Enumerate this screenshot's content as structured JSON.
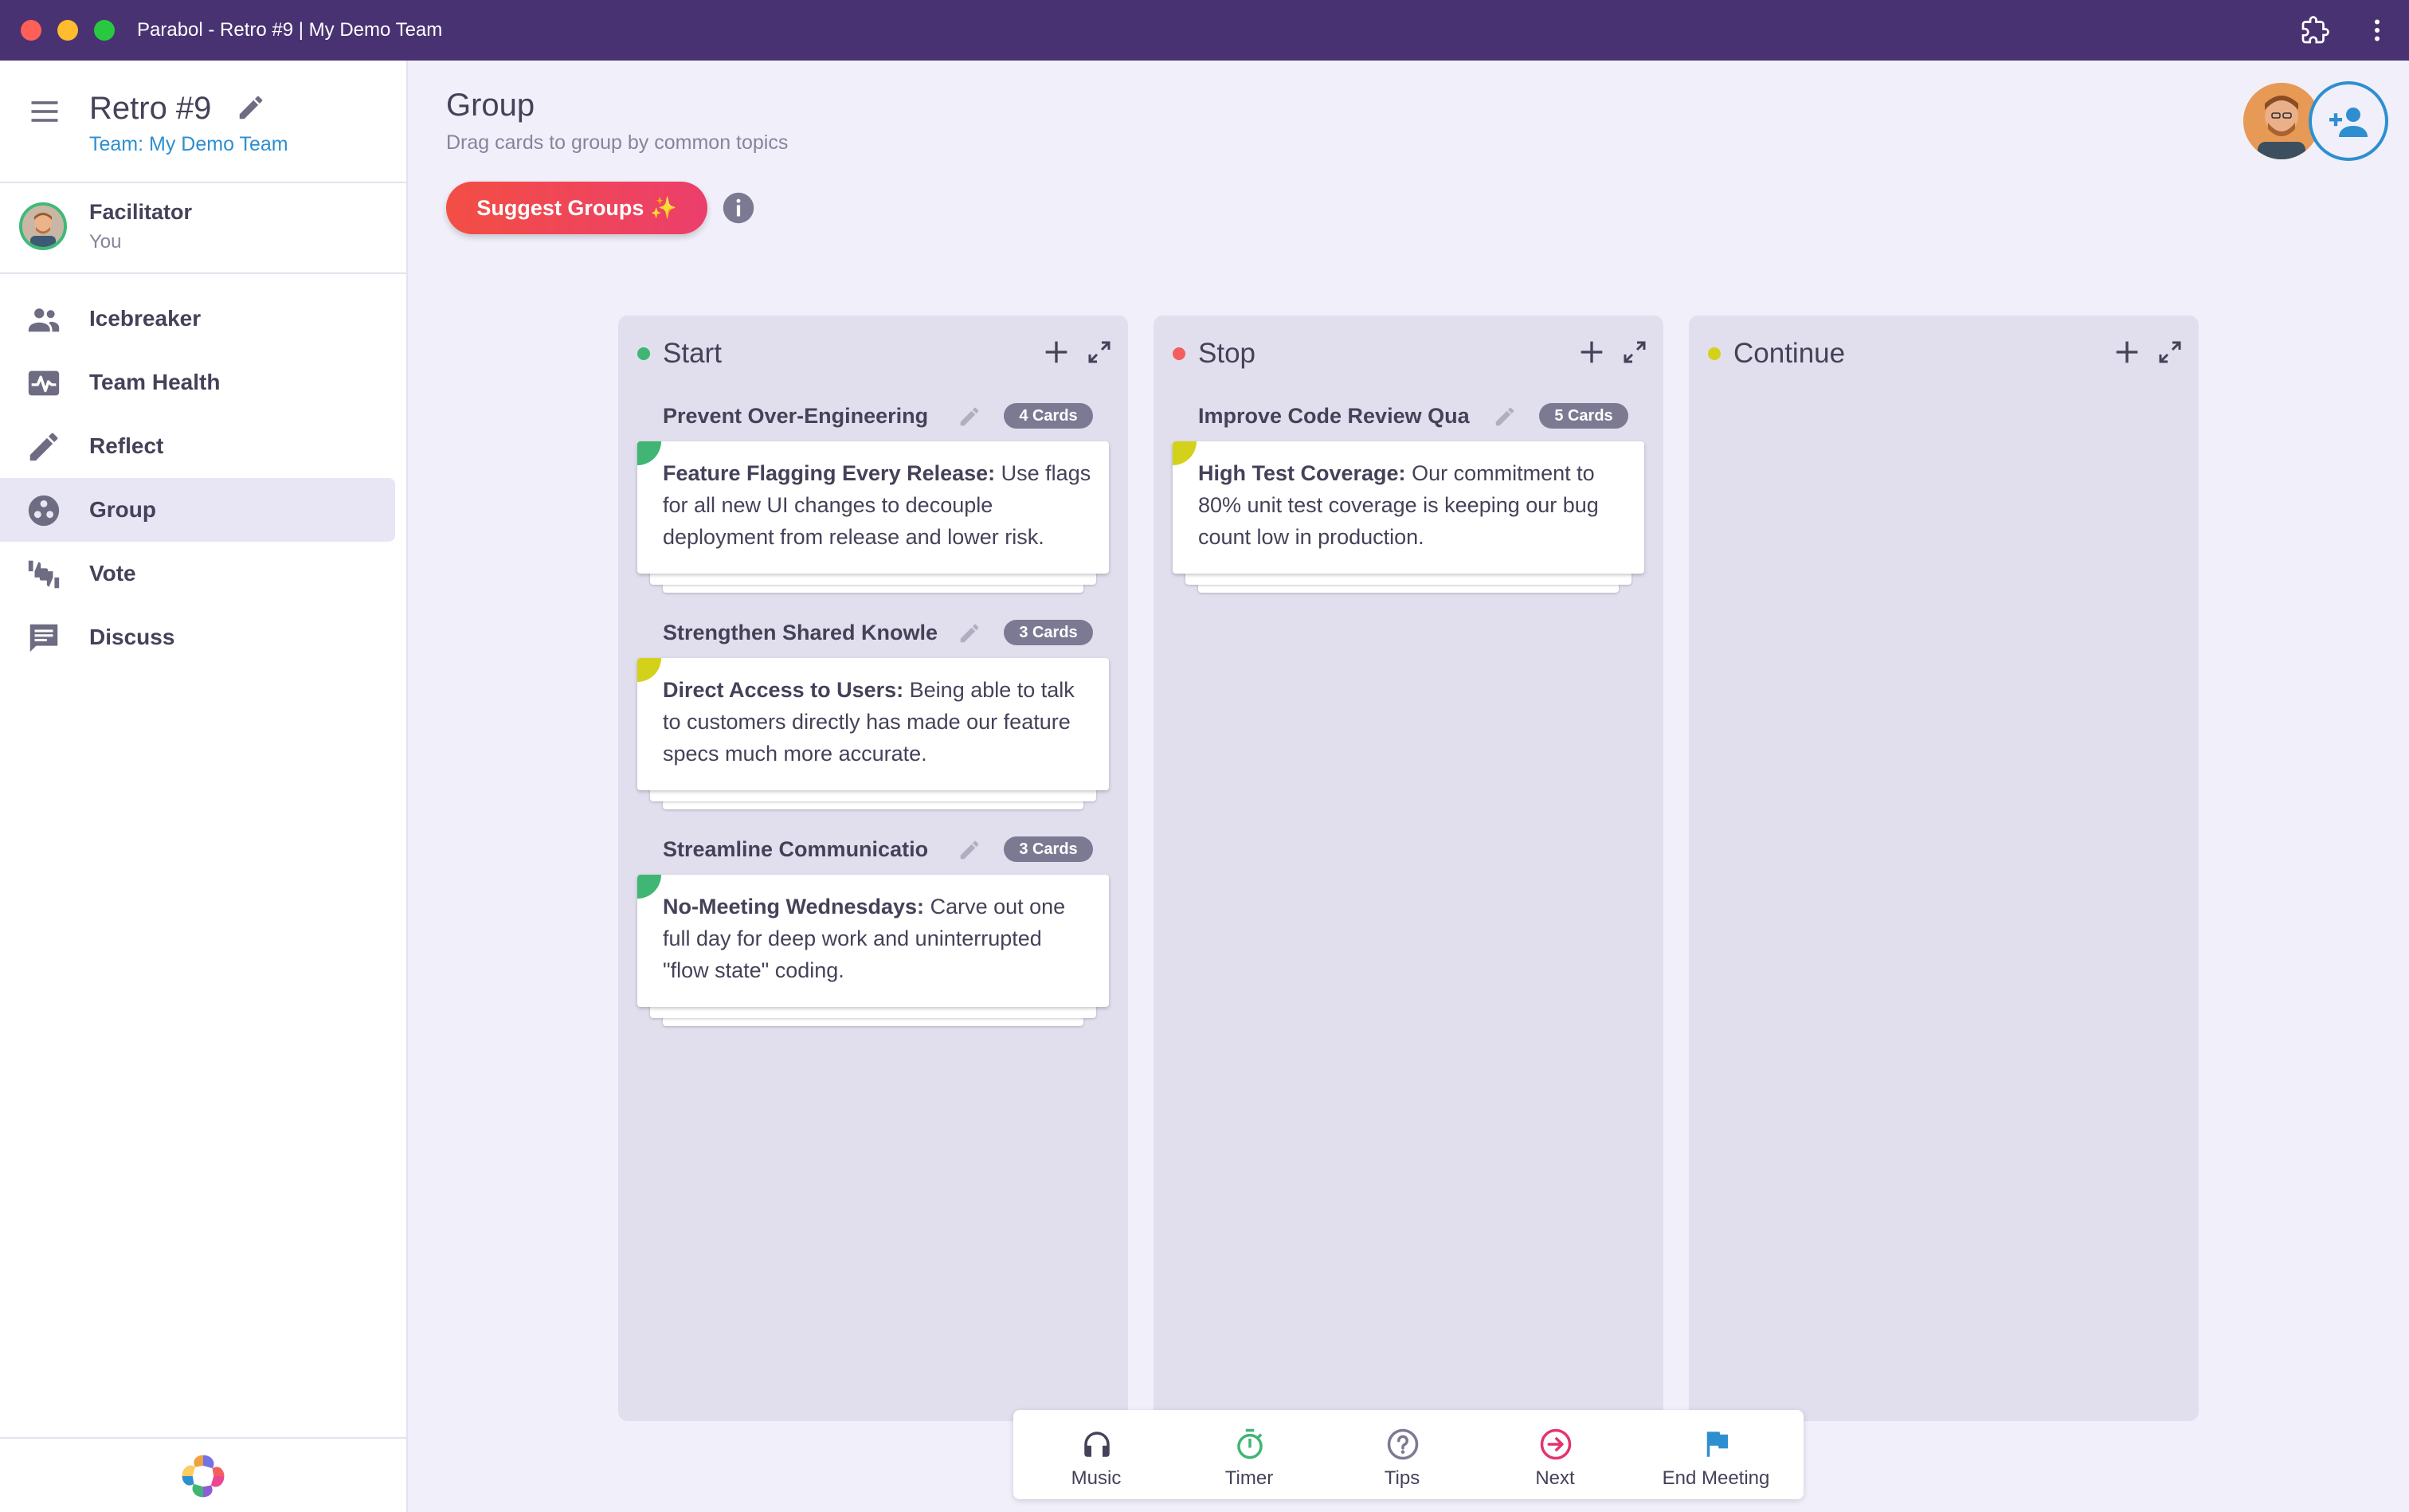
{
  "window": {
    "title": "Parabol - Retro #9 | My Demo Team"
  },
  "sidebar": {
    "meeting_title": "Retro #9",
    "team_link": "Team: My Demo Team",
    "facilitator": {
      "label": "Facilitator",
      "sub": "You"
    },
    "items": [
      {
        "label": "Icebreaker",
        "icon": "group-icon"
      },
      {
        "label": "Team Health",
        "icon": "heart-pulse-icon"
      },
      {
        "label": "Reflect",
        "icon": "pencil-icon"
      },
      {
        "label": "Group",
        "icon": "group-work-icon",
        "active": true
      },
      {
        "label": "Vote",
        "icon": "thumbs-icon"
      },
      {
        "label": "Discuss",
        "icon": "chat-icon"
      }
    ]
  },
  "main": {
    "title": "Group",
    "subtitle": "Drag cards to group by common topics",
    "suggest_label": "Suggest Groups ✨"
  },
  "columns": [
    {
      "title": "Start",
      "color": "#40b574",
      "groups": [
        {
          "title": "Prevent Over-Engineering",
          "badge": "4 Cards",
          "tag_color": "#40b574",
          "card_bold": "Feature Flagging Every Release:",
          "card_text": " Use flags for all new UI changes to decouple deployment from release and lower risk."
        },
        {
          "title": "Strengthen Shared Knowle",
          "badge": "3 Cards",
          "tag_color": "#d4d11b",
          "card_bold": "Direct Access to Users:",
          "card_text": " Being able to talk to customers directly has made our feature specs much more accurate."
        },
        {
          "title": "Streamline Communicatio",
          "badge": "3 Cards",
          "tag_color": "#40b574",
          "card_bold": "No-Meeting Wednesdays:",
          "card_text": " Carve out one full day for deep work and uninterrupted \"flow state\" coding."
        }
      ]
    },
    {
      "title": "Stop",
      "color": "#f25f5c",
      "groups": [
        {
          "title": "Improve Code Review Qua",
          "badge": "5 Cards",
          "tag_color": "#d4d11b",
          "card_bold": "High Test Coverage:",
          "card_text": " Our commitment to 80% unit test coverage is keeping our bug count low in production."
        }
      ]
    },
    {
      "title": "Continue",
      "color": "#d4d11b",
      "groups": []
    }
  ],
  "bottom_bar": {
    "items": [
      {
        "label": "Music",
        "icon": "headphones-icon",
        "color": "#444258"
      },
      {
        "label": "Timer",
        "icon": "timer-icon",
        "color": "#40b574"
      },
      {
        "label": "Tips",
        "icon": "help-icon",
        "color": "#7c7a93"
      },
      {
        "label": "Next",
        "icon": "arrow-right-circle-icon",
        "color": "#e3346f"
      },
      {
        "label": "End Meeting",
        "icon": "flag-icon",
        "color": "#2e8fd0"
      }
    ]
  }
}
